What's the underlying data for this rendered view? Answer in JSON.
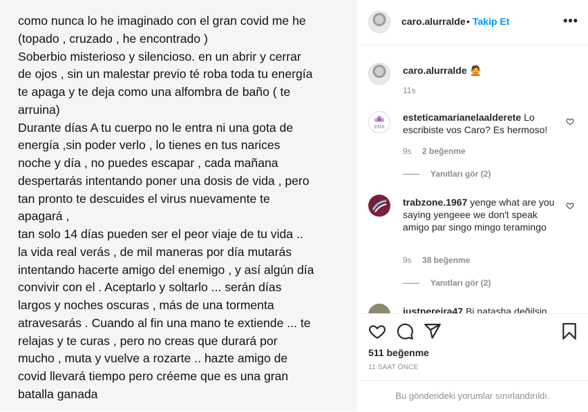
{
  "post": {
    "lines": [
      "como nunca lo he imaginado con el gran covid me he",
      "(topado , cruzado , he encontrado )",
      "Soberbio misterioso y silencioso. en un abrir y cerrar",
      "de ojos , sin un malestar previo té roba toda tu energía",
      "te apaga y te deja como una alfombra de baño ( te",
      "arruina)",
      "Durante días A tu cuerpo no le entra ni una gota de",
      "energía ,sin poder verlo , lo tienes en tus narices",
      "noche y día , no puedes escapar , cada mañana",
      "despertarás intentando poner una dosis de vida , pero",
      "tan pronto te descuides el virus nuevamente te",
      "apagará ,",
      "tan solo  14 días pueden ser el peor viaje de tu vida ..",
      "la vida real verás , de mil maneras por día mutarás",
      "intentando hacerte amigo del enemigo , y así algún día",
      "convivir con el . Aceptarlo y soltarlo ... serán días",
      "largos y noches oscuras , más de una tormenta",
      "atravesarás . Cuando al fin una mano te extiende ... te",
      "relajas y te curas , pero no creas que durará por",
      "mucho , muta y vuelve a rozarte .. hazte amigo de",
      "covid llevará tiempo pero créeme que es una gran",
      "batalla  ganada"
    ]
  },
  "header": {
    "username": "caro.alurralde",
    "dot": "•",
    "follow_label": "Takip Et",
    "more_label": "•••"
  },
  "caption": {
    "username": "caro.alurralde",
    "emoji": "🙅",
    "time": "11s"
  },
  "comments": [
    {
      "username": "esteticamarianelaalderete",
      "text": "Lo escribiste vos Caro? Es hermoso!",
      "time": "9s",
      "likes": "2 beğenme",
      "replies": "Yanıtları gör (2)",
      "avatar_text": "EMA"
    },
    {
      "username": "trabzone.1967",
      "text": "yenge what are you saying yengeee we don't speak amigo par singo mingo teramingo",
      "time": "9s",
      "likes": "38 beğenme",
      "replies": "Yanıtları gör (2)"
    },
    {
      "username": "justpereira47",
      "text": "Bi natasha değilsin"
    }
  ],
  "actions": {
    "likes": "511 beğenme",
    "time_ago": "11 SAAT ÖNCE",
    "restricted": "Bu gönderideki yorumlar sınırlandırıldı."
  },
  "colors": {
    "accent": "#0095f6",
    "muted": "#8e8e8e",
    "text": "#262626",
    "border": "#efefef"
  }
}
